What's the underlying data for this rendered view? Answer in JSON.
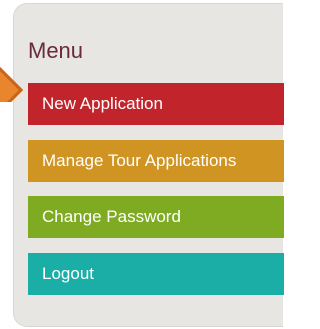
{
  "menu": {
    "title": "Menu",
    "items": [
      {
        "label": "New Application",
        "color": "#c2242b"
      },
      {
        "label": "Manage Tour Applications",
        "color": "#cf9422"
      },
      {
        "label": "Change Password",
        "color": "#7fab23"
      },
      {
        "label": "Logout",
        "color": "#1aaea7"
      }
    ]
  },
  "colors": {
    "panel_bg": "#e7e6e3",
    "title": "#6b2a3c",
    "pointer_arrow": "#e9852d"
  }
}
